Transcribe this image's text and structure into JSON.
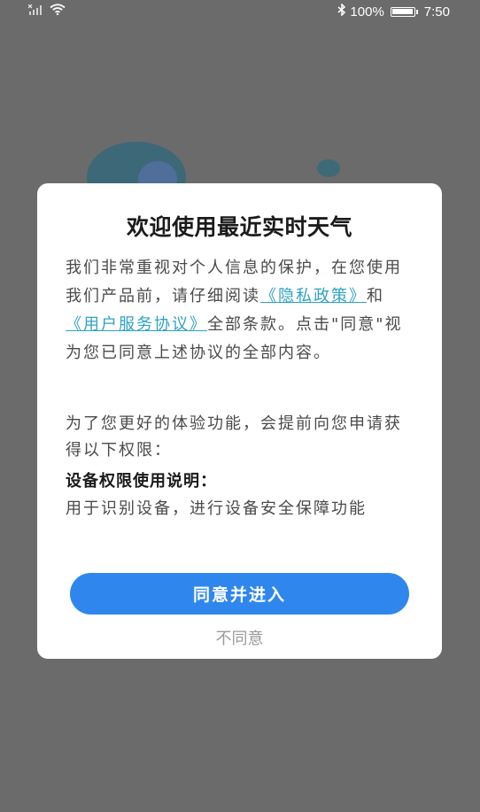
{
  "status_bar": {
    "battery": "100%",
    "time": "7:50",
    "icons": [
      "signal-icon",
      "wifi-icon",
      "bluetooth-icon",
      "battery-icon"
    ]
  },
  "dialog": {
    "title": "欢迎使用最近实时天气",
    "policy": {
      "part1": "我们非常重视对个人信息的保护，在您使用我们产品前，请仔细阅读",
      "privacy_link": "《隐私政策》",
      "and": "和",
      "service_link": "《用户服务协议》",
      "part2": "全部条款。点击\"同意\"视为您已同意上述协议的全部内容。"
    },
    "permission_intro": "为了您更好的体验功能，会提前向您申请获得以下权限：",
    "permission_title": "设备权限使用说明：",
    "permission_desc": "用于识别设备，进行设备安全保障功能",
    "agree_label": "同意并进入",
    "decline_label": "不同意"
  },
  "colors": {
    "backdrop": "#6b6b6b",
    "link": "#2fa3c4",
    "primary_button": "#2f87ee",
    "decline_text": "#9a9a9a"
  }
}
